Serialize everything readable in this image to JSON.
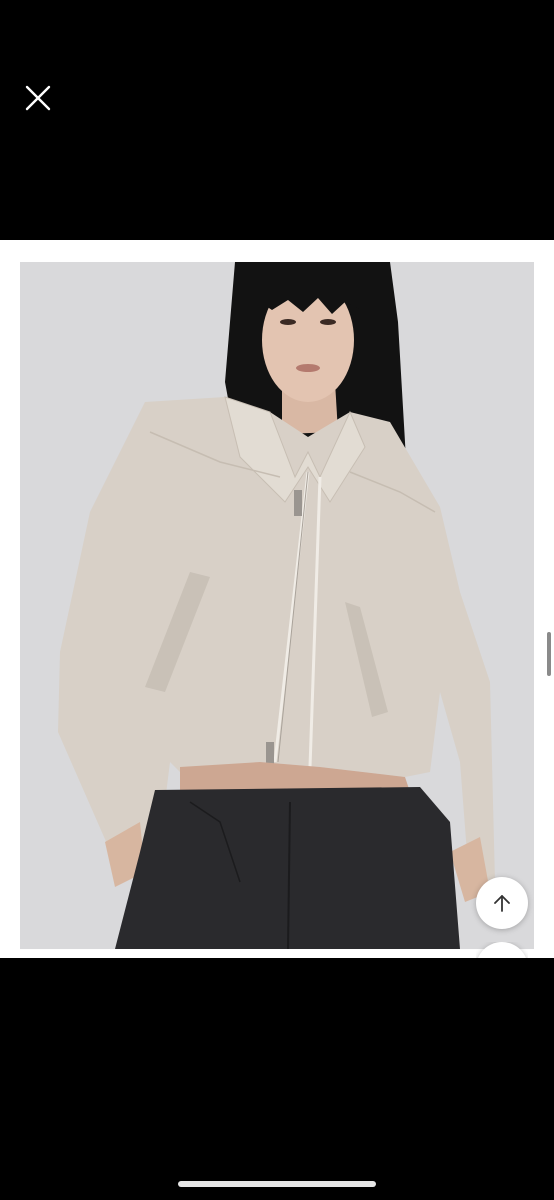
{
  "viewer": {
    "close_icon": "close-icon",
    "photo_subject": "product-photo",
    "scroll_top_icon": "arrow-up-icon"
  },
  "colors": {
    "background": "#000000",
    "frame": "#ffffff",
    "photo_bg": "#d9d9db",
    "jacket": "#d8d0c7",
    "pants": "#2a2a2d",
    "hair": "#111111"
  }
}
